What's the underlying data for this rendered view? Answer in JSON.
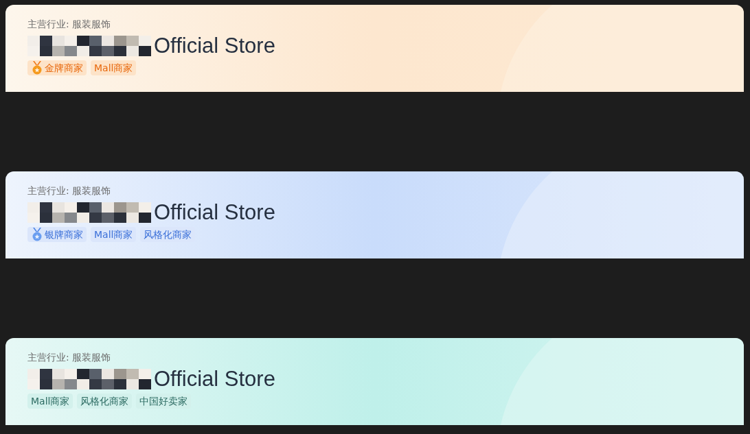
{
  "cards": [
    {
      "kind": "gold",
      "industry": "主营行业: 服装服饰",
      "store_name": "Official Store",
      "tags": [
        {
          "kind": "medal",
          "label": "金牌商家"
        },
        {
          "kind": "plain",
          "label": "Mall商家"
        }
      ]
    },
    {
      "kind": "silver",
      "industry": "主营行业: 服装服饰",
      "store_name": "Official Store",
      "tags": [
        {
          "kind": "medal",
          "label": "银牌商家"
        },
        {
          "kind": "plain",
          "label": "Mall商家"
        },
        {
          "kind": "plain",
          "label": "风格化商家"
        }
      ]
    },
    {
      "kind": "green",
      "industry": "主营行业: 服装服饰",
      "store_name": "Official Store",
      "tags": [
        {
          "kind": "plain",
          "label": "Mall商家"
        },
        {
          "kind": "plain",
          "label": "风格化商家"
        },
        {
          "kind": "plain",
          "label": "中国好卖家"
        }
      ]
    }
  ]
}
